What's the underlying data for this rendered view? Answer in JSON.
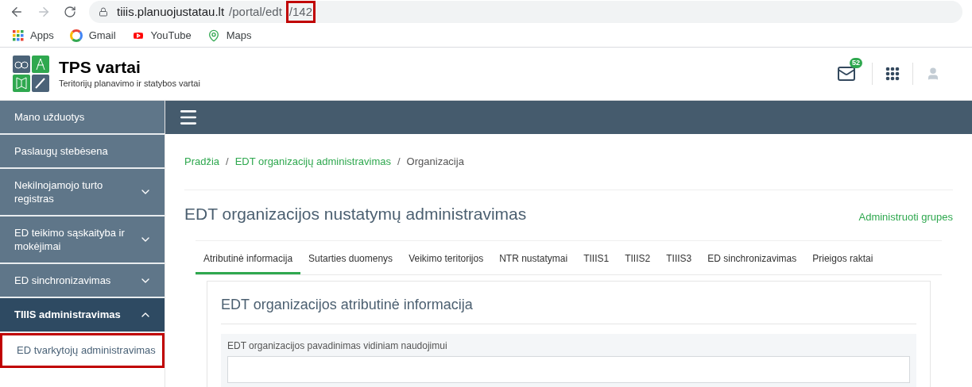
{
  "browser": {
    "url_segments": [
      {
        "text": "tiiis.planuojustatau.lt",
        "kind": "host",
        "highlighted": false
      },
      {
        "text": "/portal/edt",
        "kind": "path",
        "highlighted": false
      },
      {
        "text": "/142",
        "kind": "path",
        "highlighted": true
      }
    ],
    "bookmarks": [
      {
        "label": "Apps",
        "kind": "apps"
      },
      {
        "label": "Gmail",
        "kind": "gmail"
      },
      {
        "label": "YouTube",
        "kind": "youtube"
      },
      {
        "label": "Maps",
        "kind": "maps"
      }
    ]
  },
  "header": {
    "title": "TPS vartai",
    "subtitle": "Teritorijų planavimo ir statybos vartai",
    "mail_count": "52"
  },
  "sidebar": {
    "items": [
      {
        "label": "Mano užduotys",
        "kind": "link"
      },
      {
        "label": "Paslaugų stebėsena",
        "kind": "link"
      },
      {
        "label": "Nekilnojamojo turto registras",
        "kind": "group",
        "expanded": false
      },
      {
        "label": "ED teikimo sąskaityba ir mokėjimai",
        "kind": "group",
        "expanded": false
      },
      {
        "label": "ED sinchronizavimas",
        "kind": "group",
        "expanded": false
      },
      {
        "label": "TIIIS administravimas",
        "kind": "group",
        "expanded": true,
        "children": [
          {
            "label": "ED tvarkytojų administravimas",
            "highlighted": true
          }
        ]
      }
    ]
  },
  "breadcrumb_separator": "/",
  "breadcrumb": [
    {
      "label": "Pradžia",
      "kind": "link"
    },
    {
      "label": "EDT organizacijų administravimas",
      "kind": "link"
    },
    {
      "label": "Organizacija",
      "kind": "current"
    }
  ],
  "page_title": "EDT organizacijos nustatymų administravimas",
  "action_link": "Administruoti grupes",
  "tabs": [
    {
      "label": "Atributinė informacija",
      "selected": true
    },
    {
      "label": "Sutarties duomenys",
      "selected": false
    },
    {
      "label": "Veikimo teritorijos",
      "selected": false
    },
    {
      "label": "NTR nustatymai",
      "selected": false
    },
    {
      "label": "TIIIS1",
      "selected": false
    },
    {
      "label": "TIIIS2",
      "selected": false
    },
    {
      "label": "TIIIS3",
      "selected": false
    },
    {
      "label": "ED sinchronizavimas",
      "selected": false
    },
    {
      "label": "Prieigos raktai",
      "selected": false
    }
  ],
  "card": {
    "title": "EDT organizacijos atributinė informacija",
    "field_label": "EDT organizacijos pavadinimas vidiniam naudojimui"
  }
}
